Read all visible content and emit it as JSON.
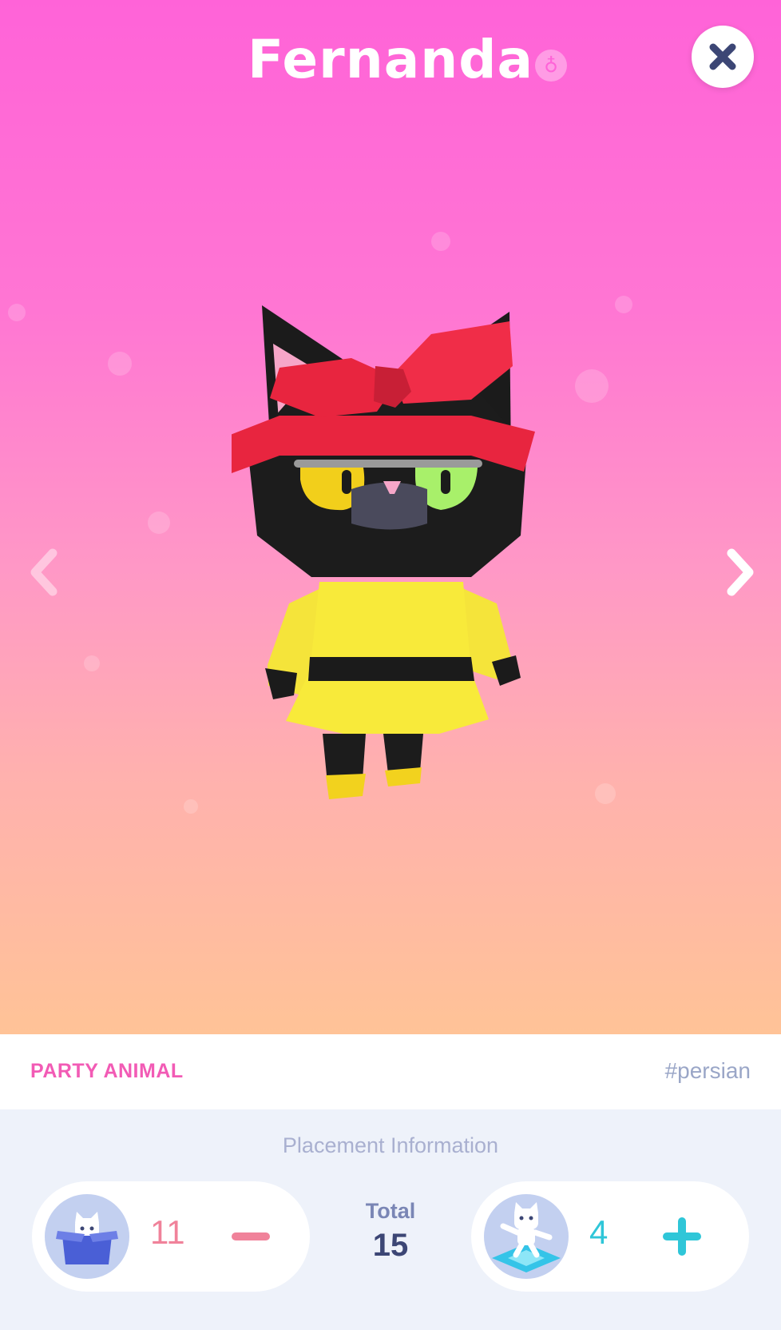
{
  "header": {
    "name": "Fernanda",
    "gender_symbol": "♁"
  },
  "icons": {
    "close": "close-icon",
    "prev": "chevron-left-icon",
    "next": "chevron-right-icon",
    "minus": "minus-icon",
    "plus": "plus-icon"
  },
  "cat": {
    "personality": "PARTY ANIMAL",
    "breed_tag": "#persian",
    "outfit": {
      "bow": "red bow",
      "dress": "yellow dress"
    }
  },
  "placement": {
    "title": "Placement Information",
    "stored": {
      "count": "11",
      "icon": "box-cat-icon"
    },
    "placed": {
      "count": "4",
      "icon": "dancing-cat-icon"
    },
    "total_label": "Total",
    "total_value": "15"
  },
  "colors": {
    "bg_top": "#ff63d8",
    "bg_bottom": "#ffc397",
    "personality": "#f25bb5",
    "breed": "#9aa6c7",
    "stored_count": "#f0829a",
    "placed_count": "#2fc6d8",
    "close_x": "#3c4675"
  }
}
